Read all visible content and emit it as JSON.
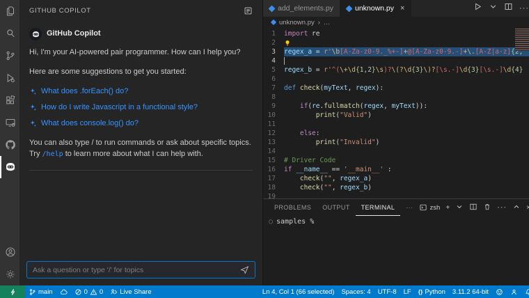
{
  "activity_bar": {
    "items": [
      {
        "name": "explorer",
        "active": false
      },
      {
        "name": "search",
        "active": false
      },
      {
        "name": "source-control",
        "active": false
      },
      {
        "name": "run-debug",
        "active": false
      },
      {
        "name": "extensions",
        "active": false
      },
      {
        "name": "remote-explorer",
        "active": false
      },
      {
        "name": "github",
        "active": false
      },
      {
        "name": "copilot-chat",
        "active": true
      },
      {
        "name": "accounts",
        "active": false,
        "bottom": true
      },
      {
        "name": "settings",
        "active": false,
        "bottom": true
      }
    ]
  },
  "sidebar": {
    "title": "GITHUB COPILOT",
    "chat": {
      "assistant_name": "GitHub Copilot",
      "greeting": "Hi, I'm your AI-powered pair programmer. How can I help you?",
      "suggestions_intro": "Here are some suggestions to get you started:",
      "suggestions": [
        "What does .forEach() do?",
        "How do I write Javascript in a functional style?",
        "What does console.log() do?"
      ],
      "hint_pre": "You can also type / to run commands or ask about specific topics. Try ",
      "hint_code": "/help",
      "hint_post": " to learn more about what I can help with."
    },
    "input": {
      "placeholder": "Ask a question or type '/' for topics"
    }
  },
  "editor": {
    "tabs": [
      {
        "label": "add_elements.py",
        "active": false
      },
      {
        "label": "unknown.py",
        "active": true,
        "close": "×"
      }
    ],
    "actions_more": "···",
    "breadcrumb": {
      "file": "unknown.py",
      "sep": "›",
      "tail": "…"
    },
    "code": {
      "lines": [
        {
          "n": 1,
          "t": [
            [
              "import",
              "k"
            ],
            [
              " re",
              "f"
            ]
          ]
        },
        {
          "n": 2,
          "t": [],
          "bulb": true
        },
        {
          "n": 3,
          "sel": true,
          "ln_on": true,
          "t": [
            [
              "regex_a",
              "v"
            ],
            [
              " = ",
              "f"
            ],
            [
              "r'",
              "s"
            ],
            [
              "\\b",
              "e"
            ],
            [
              "[A-Za-z0-9._%+-]",
              "r"
            ],
            [
              "+",
              "e"
            ],
            [
              "@",
              "r"
            ],
            [
              "[A-Za-z0-9.-]",
              "r"
            ],
            [
              "+",
              "e"
            ],
            [
              "\\.",
              "e"
            ],
            [
              "[A-Z|a-z]",
              "r"
            ],
            [
              "{2,",
              "n"
            ]
          ]
        },
        {
          "n": 4,
          "t": [],
          "cursor": true,
          "ln_on": true
        },
        {
          "n": 5,
          "t": [
            [
              "regex_b",
              "v"
            ],
            [
              " = ",
              "f"
            ],
            [
              "r'",
              "s"
            ],
            [
              "^(",
              "r"
            ],
            [
              "\\+",
              "e"
            ],
            [
              "\\d",
              "e"
            ],
            [
              "{1,2}",
              "n"
            ],
            [
              "\\s",
              "e"
            ],
            [
              ")?",
              "r"
            ],
            [
              "\\(?",
              "e"
            ],
            [
              "\\d",
              "e"
            ],
            [
              "{3}",
              "n"
            ],
            [
              "\\)?",
              "e"
            ],
            [
              "[\\s.-]",
              "r"
            ],
            [
              "\\d",
              "e"
            ],
            [
              "{3}",
              "n"
            ],
            [
              "[\\s.-]",
              "r"
            ],
            [
              "\\d",
              "e"
            ],
            [
              "{4}",
              "n"
            ]
          ]
        },
        {
          "n": 6,
          "t": []
        },
        {
          "n": 7,
          "t": [
            [
              "def ",
              "d"
            ],
            [
              "check",
              "fn"
            ],
            [
              "(",
              "f"
            ],
            [
              "myText",
              "v"
            ],
            [
              ", ",
              "f"
            ],
            [
              "regex",
              "v"
            ],
            [
              "):",
              "f"
            ]
          ]
        },
        {
          "n": 8,
          "t": []
        },
        {
          "n": 9,
          "t": [
            [
              "    ",
              "f"
            ],
            [
              "if",
              "k"
            ],
            [
              "(",
              "f"
            ],
            [
              "re",
              "v"
            ],
            [
              ".",
              "f"
            ],
            [
              "fullmatch",
              "fn"
            ],
            [
              "(",
              "f"
            ],
            [
              "regex",
              "v"
            ],
            [
              ", ",
              "f"
            ],
            [
              "myText",
              "v"
            ],
            [
              ")):",
              "f"
            ]
          ]
        },
        {
          "n": 10,
          "t": [
            [
              "        ",
              "f"
            ],
            [
              "print",
              "fn"
            ],
            [
              "(",
              "f"
            ],
            [
              "\"Valid\"",
              "s"
            ],
            [
              ")",
              "f"
            ]
          ]
        },
        {
          "n": 11,
          "t": []
        },
        {
          "n": 12,
          "t": [
            [
              "    ",
              "f"
            ],
            [
              "else",
              "k"
            ],
            [
              ":",
              "f"
            ]
          ]
        },
        {
          "n": 13,
          "t": [
            [
              "        ",
              "f"
            ],
            [
              "print",
              "fn"
            ],
            [
              "(",
              "f"
            ],
            [
              "\"Invalid\"",
              "s"
            ],
            [
              ")",
              "f"
            ]
          ]
        },
        {
          "n": 14,
          "t": []
        },
        {
          "n": 15,
          "t": [
            [
              "# Driver Code",
              "c"
            ]
          ]
        },
        {
          "n": 16,
          "t": [
            [
              "if",
              "k"
            ],
            [
              " ",
              "f"
            ],
            [
              "__name__",
              "v"
            ],
            [
              " == ",
              "f"
            ],
            [
              "'__main__'",
              "s"
            ],
            [
              " :",
              "f"
            ]
          ]
        },
        {
          "n": 17,
          "t": [
            [
              "    ",
              "f"
            ],
            [
              "check",
              "fn"
            ],
            [
              "(",
              "f"
            ],
            [
              "\"\"",
              "s"
            ],
            [
              ", ",
              "f"
            ],
            [
              "regex_a",
              "v"
            ],
            [
              ")",
              "f"
            ]
          ]
        },
        {
          "n": 18,
          "t": [
            [
              "    ",
              "f"
            ],
            [
              "check",
              "fn"
            ],
            [
              "(",
              "f"
            ],
            [
              "\"\"",
              "s"
            ],
            [
              ", ",
              "f"
            ],
            [
              "regex_b",
              "v"
            ],
            [
              ")",
              "f"
            ]
          ]
        },
        {
          "n": 19,
          "t": []
        }
      ]
    }
  },
  "panel": {
    "tabs": [
      "PROBLEMS",
      "OUTPUT",
      "TERMINAL"
    ],
    "active_tab": "TERMINAL",
    "more": "···",
    "shell": "zsh",
    "plus": "+",
    "close": "×",
    "prompt_prefix": "○",
    "prompt": "samples %"
  },
  "status_bar": {
    "branch": "main",
    "errors": "0",
    "warnings": "0",
    "live_share": "Live Share",
    "cursor": "Ln 4, Col 1 (66 selected)",
    "spaces": "Spaces: 4",
    "encoding": "UTF-8",
    "eol": "LF",
    "lang_braces": "{}",
    "language": "Python",
    "version": "3.11.2 64-bit"
  },
  "colors": {
    "accent": "#007acc",
    "remote_green": "#16825d",
    "link_blue": "#3794ff",
    "selection": "#264f78",
    "editor_bg": "#1e1e1e"
  }
}
